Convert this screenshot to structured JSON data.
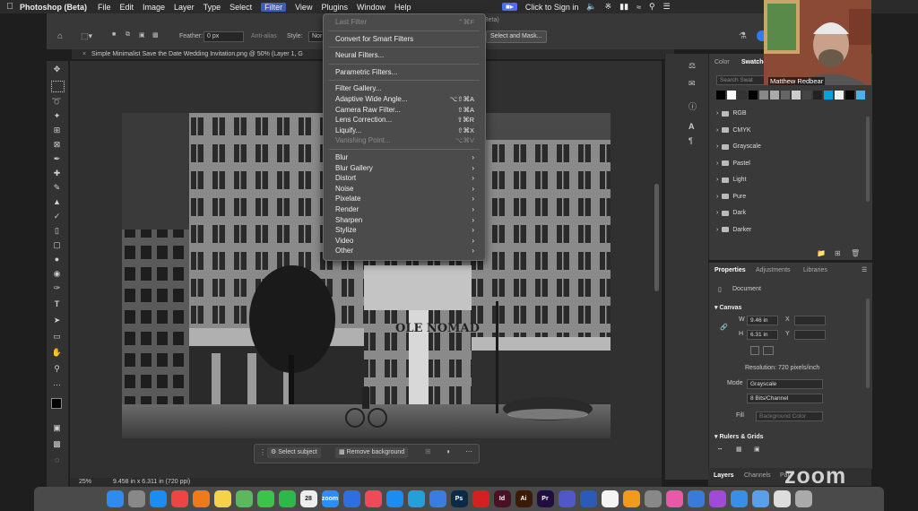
{
  "menubar": {
    "app": "Photoshop (Beta)",
    "items": [
      "File",
      "Edit",
      "Image",
      "Layer",
      "Type",
      "Select",
      "Filter",
      "View",
      "Plugins",
      "Window",
      "Help"
    ],
    "active_item": "Filter",
    "zoom_signin": "Click to Sign in",
    "colors": {
      "menubar_bg": "#2b2b2b",
      "active_bg": "#3c5fb4"
    }
  },
  "optionsbar": {
    "feather_label": "Feather:",
    "feather_value": "0 px",
    "antialias_label": "Anti-alias",
    "style_label": "Style:",
    "style_value": "Nor",
    "select_mask_button": "Select and Mask...",
    "title_fragment": "Beta)"
  },
  "document": {
    "tab_title": "Simple Minimalist Save the Date Wedding Invitation.png @ 50% (Layer 1, G",
    "zoom": "25%",
    "size_info": "9.458 in x 6.311 in (720 ppi)",
    "signage": "OLE NOMAD",
    "canvas_color": "#303030"
  },
  "context_bar": {
    "select_subject": "Select subject",
    "remove_background": "Remove background",
    "more": "···"
  },
  "filter_menu": {
    "items": [
      {
        "label": "Last Filter",
        "shortcut": "⌃⌘F",
        "disabled": true
      },
      {
        "label": "Convert for Smart Filters",
        "sep_before": true
      },
      {
        "label": "Neural Filters...",
        "sep_before": true
      },
      {
        "label": "Parametric Filters...",
        "sep_before": true
      },
      {
        "label": "Filter Gallery...",
        "sep_before": true
      },
      {
        "label": "Adaptive Wide Angle...",
        "shortcut": "⌥⇧⌘A"
      },
      {
        "label": "Camera Raw Filter...",
        "shortcut": "⇧⌘A"
      },
      {
        "label": "Lens Correction...",
        "shortcut": "⇧⌘R"
      },
      {
        "label": "Liquify...",
        "shortcut": "⇧⌘X"
      },
      {
        "label": "Vanishing Point...",
        "shortcut": "⌥⌘V",
        "disabled": true
      },
      {
        "label": "Blur",
        "submenu": true,
        "sep_before": true
      },
      {
        "label": "Blur Gallery",
        "submenu": true
      },
      {
        "label": "Distort",
        "submenu": true
      },
      {
        "label": "Noise",
        "submenu": true
      },
      {
        "label": "Pixelate",
        "submenu": true
      },
      {
        "label": "Render",
        "submenu": true
      },
      {
        "label": "Sharpen",
        "submenu": true
      },
      {
        "label": "Stylize",
        "submenu": true
      },
      {
        "label": "Video",
        "submenu": true
      },
      {
        "label": "Other",
        "submenu": true
      }
    ]
  },
  "swatches_panel": {
    "tabs": [
      "Color",
      "Swatche"
    ],
    "active_tab": "Swatche",
    "search_placeholder": "Search Swat",
    "swatch_colors": [
      "#000000",
      "#ffffff",
      "#333333",
      "#000000",
      "#888888",
      "#aaaaaa",
      "#666666",
      "#cccccc",
      "#444444",
      "#222222",
      "#0aa0e0",
      "#eeeeee",
      "#0a0a0a",
      "#4ab0e8"
    ],
    "folders": [
      "RGB",
      "CMYK",
      "Grayscale",
      "Pastel",
      "Light",
      "Pure",
      "Dark",
      "Darker"
    ]
  },
  "properties_panel": {
    "tabs": [
      "Properties",
      "Adjustments",
      "Libraries"
    ],
    "active_tab": "Properties",
    "document_label": "Document",
    "canvas_section": "Canvas",
    "w_label": "W",
    "w_value": "9.46 in",
    "h_label": "H",
    "h_value": "6.31 in",
    "x_label": "X",
    "y_label": "Y",
    "resolution": "Resolution: 720 pixels/inch",
    "mode_label": "Mode",
    "mode_value": "Grayscale",
    "bits_value": "8 Bits/Channel",
    "fill_label": "Fill",
    "fill_value": "Background Color",
    "rulers_section": "Rulers & Grids"
  },
  "layers_tabs": [
    "Layers",
    "Channels",
    "Pat"
  ],
  "webcam": {
    "name": "Matthew Redbear"
  },
  "zoom_logo": "zoom",
  "dock": {
    "calendar_day": "28",
    "apps": [
      {
        "name": "Finder",
        "color": "#2f8bf0",
        "label": ""
      },
      {
        "name": "Launchpad",
        "color": "#888",
        "label": ""
      },
      {
        "name": "Safari",
        "color": "#1a8cf2",
        "label": ""
      },
      {
        "name": "Chrome",
        "color": "#e44",
        "label": ""
      },
      {
        "name": "Firefox",
        "color": "#f07a1a",
        "label": ""
      },
      {
        "name": "Notes",
        "color": "#f5d24a",
        "label": ""
      },
      {
        "name": "Maps",
        "color": "#5cb85c",
        "label": ""
      },
      {
        "name": "Messages",
        "color": "#3bc34a",
        "label": ""
      },
      {
        "name": "FaceTime",
        "color": "#2fb84a",
        "label": ""
      },
      {
        "name": "Calendar",
        "color": "#eee",
        "label": "28"
      },
      {
        "name": "Zoom",
        "color": "#2d8cff",
        "label": "zoom"
      },
      {
        "name": "Keynote",
        "color": "#2f6ee0",
        "label": ""
      },
      {
        "name": "Music",
        "color": "#f04a5a",
        "label": ""
      },
      {
        "name": "AppStore",
        "color": "#1a8cf2",
        "label": ""
      },
      {
        "name": "Vectornator",
        "color": "#24a0d8",
        "label": ""
      },
      {
        "name": "Tiles",
        "color": "#3b7ce0",
        "label": ""
      },
      {
        "name": "Photoshop",
        "color": "#0b2a46",
        "label": "Ps"
      },
      {
        "name": "Acrobat",
        "color": "#d42020",
        "label": ""
      },
      {
        "name": "InDesign",
        "color": "#4a1024",
        "label": "Id"
      },
      {
        "name": "Illustrator",
        "color": "#3b1a06",
        "label": "Ai"
      },
      {
        "name": "Premiere",
        "color": "#1f0f40",
        "label": "Pr"
      },
      {
        "name": "Teams",
        "color": "#5058c8",
        "label": ""
      },
      {
        "name": "Word",
        "color": "#2b5bb7",
        "label": ""
      },
      {
        "name": "Slack",
        "color": "#f4f4f4",
        "label": ""
      },
      {
        "name": "Pages",
        "color": "#f29a1a",
        "label": ""
      },
      {
        "name": "Preview",
        "color": "#888",
        "label": ""
      },
      {
        "name": "Arc",
        "color": "#e85aa8",
        "label": ""
      },
      {
        "name": "Screens",
        "color": "#3a7ad8",
        "label": ""
      },
      {
        "name": "Podcasts",
        "color": "#a04ad8",
        "label": ""
      },
      {
        "name": "Files",
        "color": "#3b8ee8",
        "label": ""
      },
      {
        "name": "Folder",
        "color": "#5aa0e8",
        "label": ""
      },
      {
        "name": "Doc",
        "color": "#ddd",
        "label": ""
      },
      {
        "name": "Trash",
        "color": "#aaa",
        "label": ""
      }
    ]
  }
}
